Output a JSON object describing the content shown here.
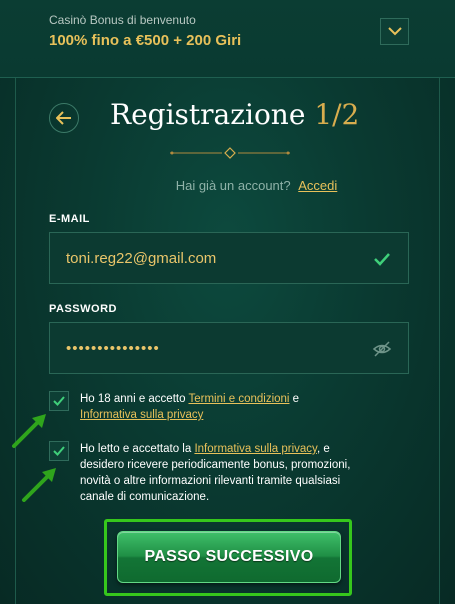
{
  "bonus": {
    "caption": "Casinò Bonus di benvenuto",
    "title": "100% fino a €500 + 200 Giri"
  },
  "header": {
    "title": "Registrazione",
    "step": "1/2"
  },
  "login_prompt": {
    "text": "Hai già un account?",
    "link": "Accedi"
  },
  "email": {
    "label": "E-MAIL",
    "value": "toni.reg22@gmail.com",
    "valid": true
  },
  "password": {
    "label": "PASSWORD",
    "value": "•••••••••••••••"
  },
  "terms": {
    "checked": true,
    "text_1": "Ho 18 anni e accetto ",
    "link_1": "Termini e condizioni",
    "text_2": " e",
    "link_2": "Informativa sulla privacy"
  },
  "marketing": {
    "checked": true,
    "text_1": "Ho letto e accettato la ",
    "link_1": "Informativa sulla privacy",
    "text_2": ", e desidero ricevere periodicamente bonus, promozioni, novità o altre informazioni rilevanti tramite qualsiasi canale di comunicazione."
  },
  "cta": {
    "label": "PASSO SUCCESSIVO"
  },
  "icons": {
    "bonus_toggle": "chevron-down-icon",
    "back": "arrow-left-icon",
    "email_valid": "check-icon",
    "password_toggle": "eye-off-icon",
    "annotation": "arrow-icon"
  },
  "colors": {
    "background": "#0a3a31",
    "accent_gold": "#e8c15a",
    "cta_green": "#1f8f45",
    "highlight_green": "#36c71c"
  }
}
